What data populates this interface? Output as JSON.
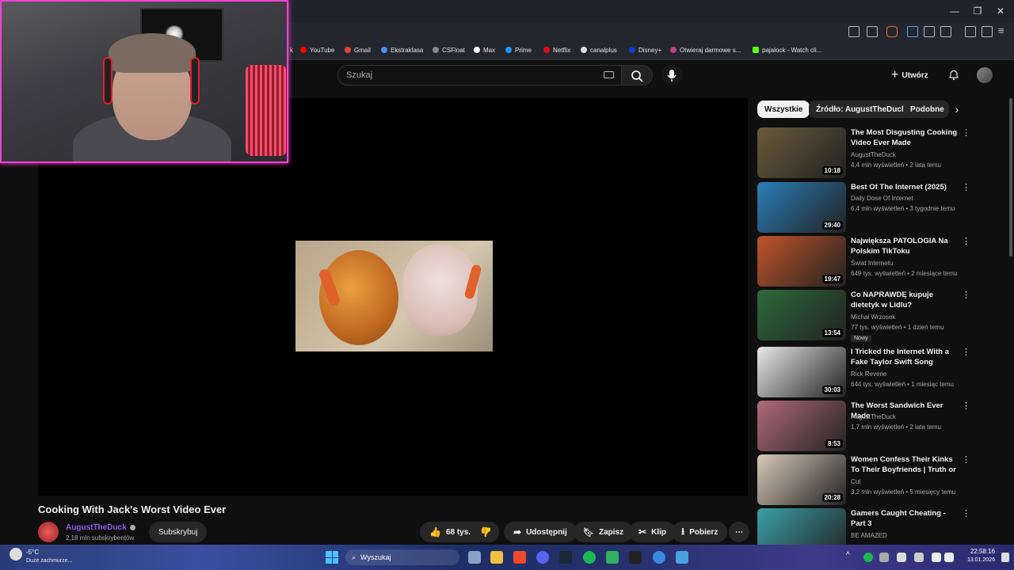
{
  "bookmarks": [
    "YouTube",
    "Gmail",
    "Ekstraklasa",
    "CSFloat",
    "Max",
    "Prime",
    "Netflix",
    "canalplus",
    "Disney+",
    "Otwieraj darmowe s...",
    "pajalock - Watch cli..."
  ],
  "header": {
    "search_placeholder": "Szukaj",
    "create_label": "Utwórz"
  },
  "video": {
    "title": "Cooking With Jack's Worst Video Ever",
    "channel": "AugustTheDuck",
    "subscribers": "2,18 mln subskrybentów",
    "subscribe_label": "Subskrybuj",
    "likes": "68 tys.",
    "share_label": "Udostępnij",
    "save_label": "Zapisz",
    "clip_label": "Klip",
    "download_label": "Pobierz"
  },
  "chips": [
    "Wszystkie",
    "Źródło: AugustTheDuck",
    "Podobne"
  ],
  "recommendations": [
    {
      "title": "The Most Disgusting Cooking Video Ever Made",
      "channel": "AugustTheDuck",
      "meta": "4,4 mln wyświetleń • 2 lata temu",
      "duration": "10:18",
      "thumb_color": "#6b5a3a"
    },
    {
      "title": "Best Of The Internet (2025)",
      "channel": "Daily Dose Of Internet",
      "meta": "6,4 mln wyświetleń • 3 tygodnie temu",
      "duration": "29:40",
      "thumb_color": "#2a7fb8"
    },
    {
      "title": "Największa PATOLOGIA Na Polskim TikToku",
      "channel": "Świat Internetu",
      "meta": "649 tys. wyświetleń • 2 miesiące temu",
      "duration": "19:47",
      "thumb_color": "#c0542a"
    },
    {
      "title": "Co NAPRAWDĘ kupuje dietetyk w Lidlu?",
      "channel": "Michał Wrzosek",
      "meta": "77 tys. wyświetleń • 1 dzień temu",
      "duration": "13:54",
      "thumb_color": "#2c6a3a",
      "badge": "Nowy"
    },
    {
      "title": "I Tricked the Internet With a Fake Taylor Swift Song",
      "channel": "Rick Reverie",
      "meta": "644 tys. wyświetleń • 1 miesiąc temu",
      "duration": "30:03",
      "thumb_color": "#e8e8e8"
    },
    {
      "title": "The Worst Sandwich Ever Made",
      "channel": "AugustTheDuck",
      "meta": "1,7 mln wyświetleń • 2 lata temu",
      "duration": "8:53",
      "thumb_color": "#b06a78"
    },
    {
      "title": "Women Confess Their Kinks To Their Boyfriends | Truth or Drin...",
      "channel": "Cut",
      "meta": "3,2 mln wyświetleń • 5 miesięcy temu",
      "duration": "20:28",
      "thumb_color": "#d9c9b8"
    },
    {
      "title": "Gamers Caught Cheating - Part 3",
      "channel": "BE AMAZED",
      "meta": "",
      "duration": "",
      "thumb_color": "#3aa0a8"
    }
  ],
  "taskbar": {
    "weather_temp": "-5°C",
    "weather_desc": "Duże zachmurze...",
    "search_label": "Wyszukaj",
    "time": "22:58:16",
    "date": "13.01.2026"
  }
}
